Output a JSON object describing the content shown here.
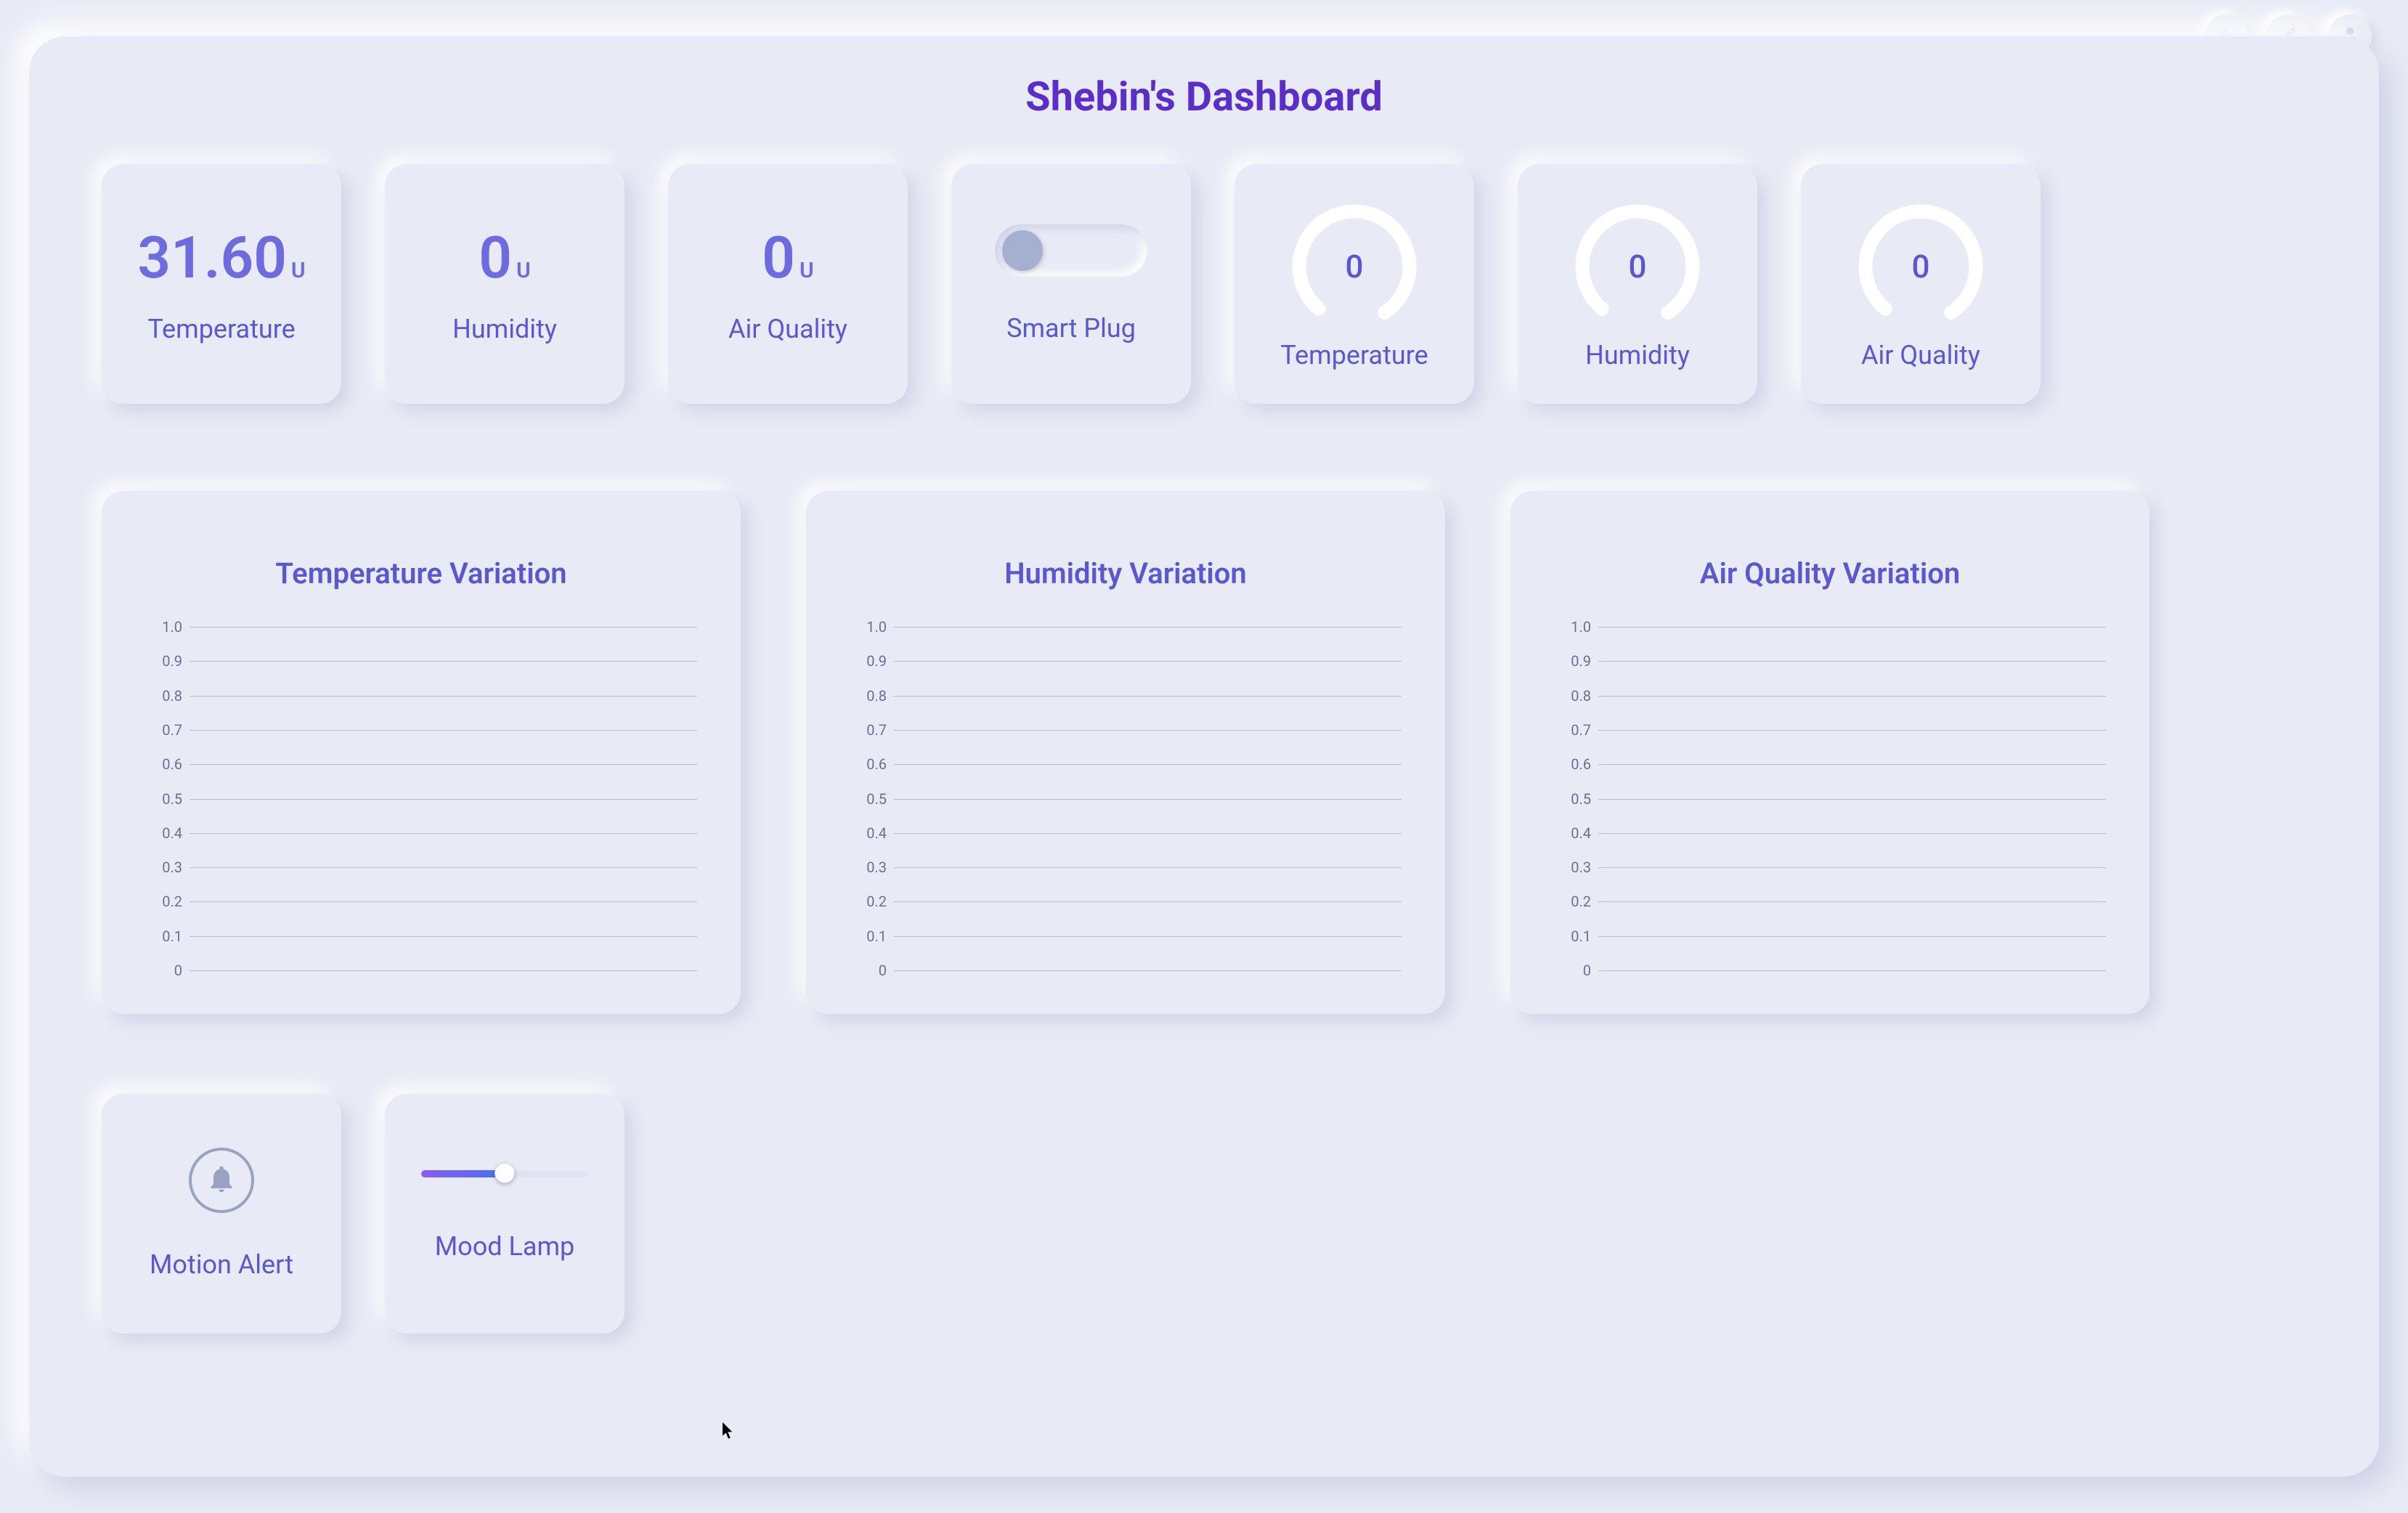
{
  "header": {
    "title": "Shebin's Dashboard"
  },
  "topbar": {
    "add_name": "add-icon",
    "edit_name": "edit-icon",
    "user_name": "user-icon"
  },
  "cards": {
    "temperature_value": "31.60",
    "temperature_unit": "U",
    "temperature_label": "Temperature",
    "humidity_value": "0",
    "humidity_unit": "U",
    "humidity_label": "Humidity",
    "airquality_value": "0",
    "airquality_unit": "U",
    "airquality_label": "Air Quality",
    "smartplug_label": "Smart Plug",
    "smartplug_state": "off"
  },
  "gauges": {
    "temperature_value": "0",
    "temperature_label": "Temperature",
    "humidity_value": "0",
    "humidity_label": "Humidity",
    "airquality_value": "0",
    "airquality_label": "Air Quality"
  },
  "charts": {
    "temp_title": "Temperature Variation",
    "hum_title": "Humidity Variation",
    "aq_title": "Air Quality Variation",
    "ticks": [
      "1.0",
      "0.9",
      "0.8",
      "0.7",
      "0.6",
      "0.5",
      "0.4",
      "0.3",
      "0.2",
      "0.1",
      "0"
    ]
  },
  "bottom": {
    "motion_label": "Motion Alert",
    "mood_label": "Mood Lamp",
    "mood_slider_value": 48
  },
  "chart_data": [
    {
      "type": "line",
      "title": "Temperature Variation",
      "x": [],
      "values": [],
      "ylim": [
        0,
        1
      ],
      "yticks": [
        0,
        0.1,
        0.2,
        0.3,
        0.4,
        0.5,
        0.6,
        0.7,
        0.8,
        0.9,
        1.0
      ]
    },
    {
      "type": "line",
      "title": "Humidity Variation",
      "x": [],
      "values": [],
      "ylim": [
        0,
        1
      ],
      "yticks": [
        0,
        0.1,
        0.2,
        0.3,
        0.4,
        0.5,
        0.6,
        0.7,
        0.8,
        0.9,
        1.0
      ]
    },
    {
      "type": "line",
      "title": "Air Quality Variation",
      "x": [],
      "values": [],
      "ylim": [
        0,
        1
      ],
      "yticks": [
        0,
        0.1,
        0.2,
        0.3,
        0.4,
        0.5,
        0.6,
        0.7,
        0.8,
        0.9,
        1.0
      ]
    }
  ]
}
